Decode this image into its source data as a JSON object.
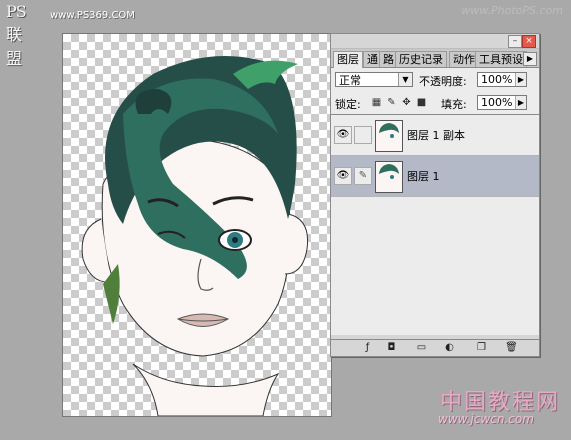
{
  "watermark": {
    "logo": "PS联盟",
    "site": "www.PS369.COM",
    "top_right": "www.PhotoPS.com",
    "bottom_right_cn": "中国教程网",
    "bottom_right_url": "www.jcwcn.com"
  },
  "panel": {
    "tabs": [
      {
        "label": "图层",
        "active": true
      },
      {
        "label": "通",
        "active": false
      },
      {
        "label": "路",
        "active": false
      },
      {
        "label": "历史记录",
        "active": false
      },
      {
        "label": "动作",
        "active": false
      },
      {
        "label": "工具预设",
        "active": false
      }
    ],
    "blend_mode": "正常",
    "opacity_label": "不透明度:",
    "opacity_value": "100%",
    "lock_label": "锁定:",
    "fill_label": "填充:",
    "fill_value": "100%",
    "layers": [
      {
        "name": "图层 1 副本",
        "visible": true,
        "selected": false
      },
      {
        "name": "图层 1",
        "visible": true,
        "selected": true
      }
    ],
    "bottom_icons": [
      "link-layers-icon",
      "add-style-icon",
      "add-mask-icon",
      "new-group-icon",
      "adjustment-layer-icon",
      "new-layer-icon",
      "trash-icon"
    ]
  },
  "colors": {
    "hair_dark": "#1f3f3a",
    "hair_mid": "#2f6f5f",
    "hair_light": "#3fa06a",
    "skin": "#fbf6f3",
    "eye": "#2e7b82",
    "selected_layer": "#b4b9c8"
  }
}
